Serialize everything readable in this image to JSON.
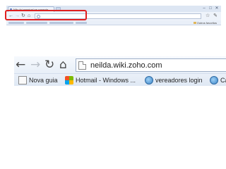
{
  "thumbnail": {
    "tab_title": "Não foi possível se conecta...",
    "window_controls": [
      "–",
      "□",
      "✕"
    ],
    "nav_icons": [
      "back-arrow",
      "forward-arrow",
      "reload",
      "home"
    ],
    "right_icons": [
      "star-icon",
      "wrench-icon"
    ],
    "other_bookmarks_label": "Outros favoritos",
    "highlight_color": "#e02020"
  },
  "zoomed": {
    "nav": {
      "back_glyph": "←",
      "forward_glyph": "→",
      "reload_glyph": "↻",
      "home_glyph": "⌂"
    },
    "address_value": "neilda.wiki.zoho.com",
    "bookmarks": [
      {
        "label": "Nova guia",
        "icon": "page-icon"
      },
      {
        "label": "Hotmail - Windows ...",
        "icon": "windows-icon"
      },
      {
        "label": "vereadores login",
        "icon": "globe-icon"
      },
      {
        "label": "Cá",
        "icon": "globe-icon"
      }
    ]
  }
}
